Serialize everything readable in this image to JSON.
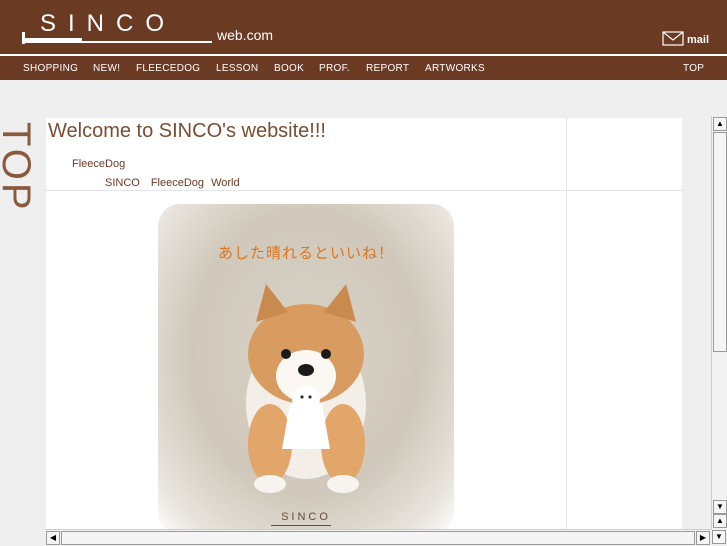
{
  "header": {
    "logo": "SINCO",
    "domain": "web.com",
    "mail_label": "mail"
  },
  "nav": {
    "items": [
      "SHOPPING",
      "NEW!",
      "FLEECEDOG",
      "LESSON",
      "BOOK",
      "PROF.",
      "REPORT",
      "ARTWORKS"
    ],
    "top": "TOP"
  },
  "side_title": "TOP",
  "main": {
    "welcome": "Welcome to SINCO's website!!!",
    "sub1": "FleeceDog",
    "sub2": "SINCO　FleeceDog World",
    "photo_caption": "あした晴れるといいね！",
    "photo_logo": "SINCO"
  },
  "icons": [
    "mail-icon",
    "scroll-up-arrow",
    "scroll-down-arrow",
    "scroll-left-arrow",
    "scroll-right-arrow"
  ]
}
